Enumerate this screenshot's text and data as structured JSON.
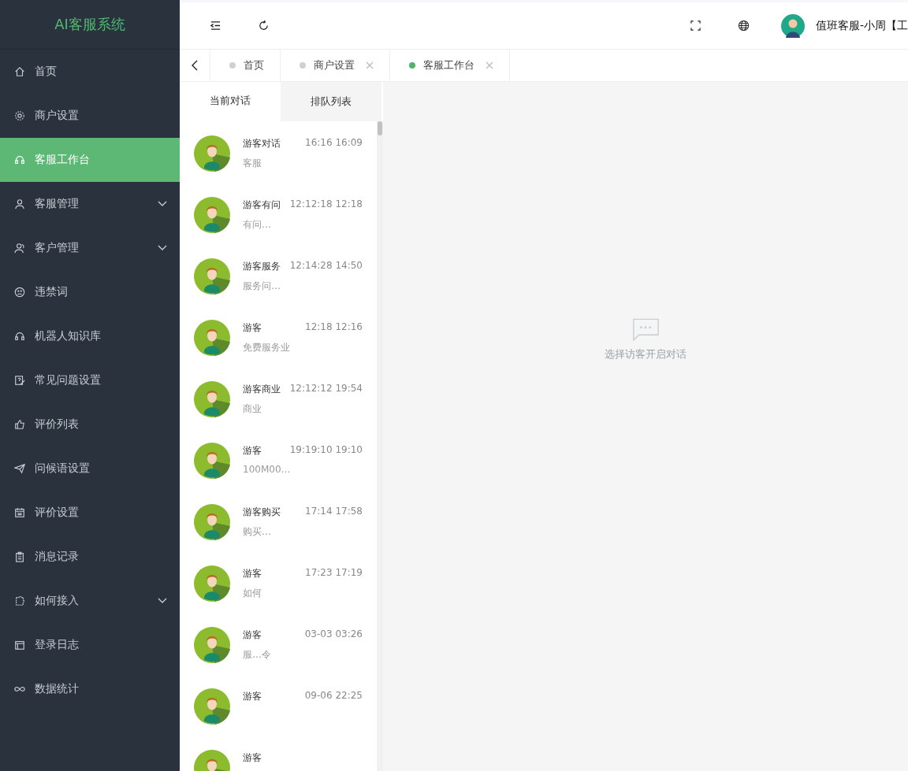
{
  "sidebar": {
    "logo": "AI客服系统",
    "items": [
      {
        "label": "首页",
        "selected": false,
        "expandable": false
      },
      {
        "label": "商户设置",
        "selected": false,
        "expandable": false
      },
      {
        "label": "客服工作台",
        "selected": true,
        "expandable": false
      },
      {
        "label": "客服管理",
        "selected": false,
        "expandable": true
      },
      {
        "label": "客户管理",
        "selected": false,
        "expandable": true
      },
      {
        "label": "违禁词",
        "selected": false,
        "expandable": false
      },
      {
        "label": "机器人知识库",
        "selected": false,
        "expandable": false
      },
      {
        "label": "常见问题设置",
        "selected": false,
        "expandable": false
      },
      {
        "label": "评价列表",
        "selected": false,
        "expandable": false
      },
      {
        "label": "问候语设置",
        "selected": false,
        "expandable": false
      },
      {
        "label": "评价设置",
        "selected": false,
        "expandable": false
      },
      {
        "label": "消息记录",
        "selected": false,
        "expandable": false
      },
      {
        "label": "如何接入",
        "selected": false,
        "expandable": true
      },
      {
        "label": "登录日志",
        "selected": false,
        "expandable": false
      },
      {
        "label": "数据统计",
        "selected": false,
        "expandable": false
      }
    ]
  },
  "header": {
    "user": "值班客服-小周【工"
  },
  "tabs": [
    {
      "label": "首页",
      "selected": false,
      "closable": false
    },
    {
      "label": "商户设置",
      "selected": false,
      "closable": true
    },
    {
      "label": "客服工作台",
      "selected": true,
      "closable": true
    }
  ],
  "chat_tabs": [
    {
      "label": "当前对话",
      "selected": true
    },
    {
      "label": "排队列表",
      "selected": false
    }
  ],
  "conversations": [
    {
      "name": "游客对话",
      "time": "16:16 16:09",
      "preview": "客服"
    },
    {
      "name": "游客有问",
      "time": "12:12:18 12:18",
      "preview": "有问…"
    },
    {
      "name": "游客服务",
      "time": "12:14:28 14:50",
      "preview": "服务问…"
    },
    {
      "name": "游客",
      "time": "12:18 12:16",
      "preview": "免费服务业"
    },
    {
      "name": "游客商业",
      "time": "12:12:12 19:54",
      "preview": "商业"
    },
    {
      "name": "游客",
      "time": "19:19:10 19:10",
      "preview": "100M00…"
    },
    {
      "name": "游客购买",
      "time": "17:14 17:58",
      "preview": "购买…"
    },
    {
      "name": "游客",
      "time": "17:23 17:19",
      "preview": "如何"
    },
    {
      "name": "游客",
      "time": "03-03 03:26",
      "preview": "服…令"
    },
    {
      "name": "游客",
      "time": "09-06 22:25"
    },
    {
      "name": "游客"
    }
  ],
  "empty_state": "选择访客开启对话"
}
